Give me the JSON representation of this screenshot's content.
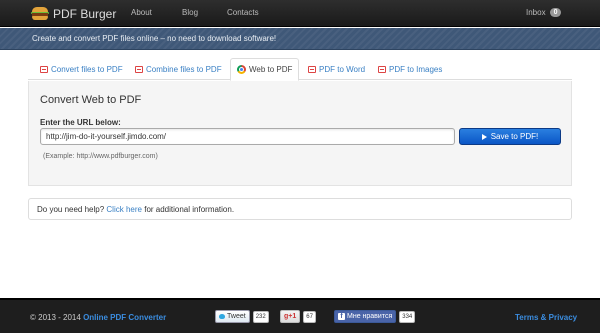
{
  "navbar": {
    "brand": "PDF Burger",
    "links": [
      "About",
      "Blog",
      "Contacts"
    ],
    "inbox_label": "Inbox",
    "inbox_count": "0"
  },
  "tagline": "Create and convert PDF files online – no need to download software!",
  "tabs": [
    {
      "label": "Convert files to PDF",
      "icon": "pdf-file-icon",
      "active": false
    },
    {
      "label": "Combine files to PDF",
      "icon": "pdf-file-icon",
      "active": false
    },
    {
      "label": "Web to PDF",
      "icon": "chrome-icon",
      "active": true
    },
    {
      "label": "PDF to Word",
      "icon": "pdf-file-icon",
      "active": false
    },
    {
      "label": "PDF to Images",
      "icon": "pdf-file-icon",
      "active": false
    }
  ],
  "panel": {
    "title": "Convert Web to PDF",
    "url_label": "Enter the URL below:",
    "url_value": "http://jim-do-it-yourself.jimdo.com/",
    "save_label": "Save to PDF!",
    "example": "(Example: http://www.pdfburger.com)"
  },
  "help": {
    "prefix": "Do you need help?",
    "link": "Click here",
    "suffix": "for additional information."
  },
  "footer": {
    "copyright": "© 2013 - 2014",
    "converter_link": "Online PDF Converter",
    "tweet_label": "Tweet",
    "tweet_count": "232",
    "gplus_label": "g+1",
    "gplus_count": "67",
    "fb_label": "Мне нравится",
    "fb_count": "334",
    "terms": "Terms & Privacy"
  },
  "colors": {
    "navbar": "#222222",
    "tagline_bar": "#3f5878",
    "link": "#3a80c4",
    "primary_button": "#0b56c6"
  }
}
